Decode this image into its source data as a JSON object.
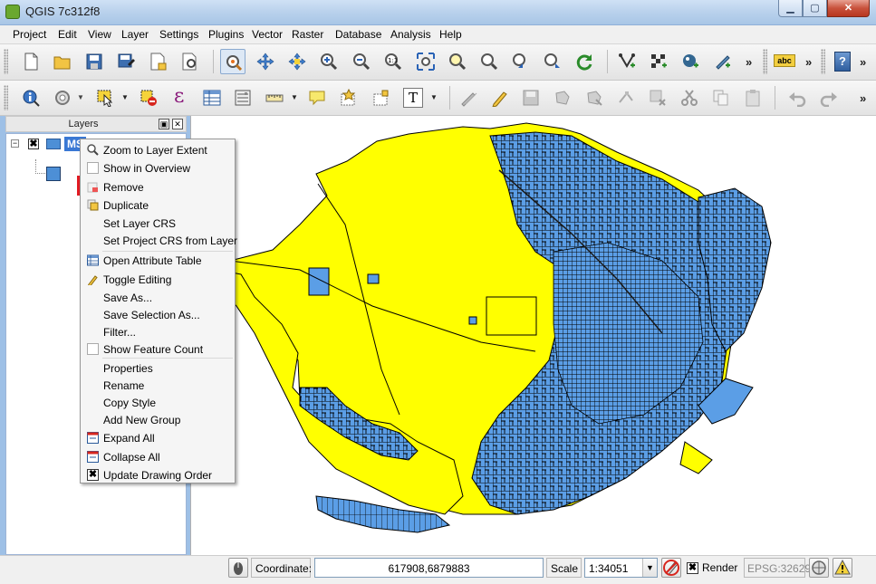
{
  "window": {
    "title": "QGIS 7c312f8",
    "minimize_label": "▁",
    "maximize_label": "▢",
    "close_label": "✕"
  },
  "menubar": {
    "items": [
      "Project",
      "Edit",
      "View",
      "Layer",
      "Settings",
      "Plugins",
      "Vector",
      "Raster",
      "Database",
      "Analysis",
      "Help"
    ]
  },
  "toolbar1": {
    "icons": [
      "new-project-icon",
      "open-project-icon",
      "save-project-icon",
      "save-as-icon",
      "new-print-composer-icon",
      "composer-manager-icon",
      "pan-map-icon",
      "pan-to-selection-icon",
      "touch-zoom-icon",
      "zoom-in-icon",
      "zoom-out-icon",
      "zoom-actual-size-icon",
      "zoom-full-icon",
      "zoom-to-selection-icon",
      "zoom-to-layer-icon",
      "zoom-last-icon",
      "zoom-next-icon",
      "refresh-icon",
      "add-vector-layer-icon",
      "add-raster-layer-icon",
      "add-postgis-layer-icon",
      "add-spatialite-layer-icon",
      "label-icon",
      "help-icon"
    ],
    "overflow": "»",
    "label_button": "abc",
    "help_button": "?"
  },
  "toolbar2": {
    "icons": [
      "identify-icon",
      "measure-icon",
      "select-icon",
      "deselect-icon",
      "expression-select-icon",
      "attribute-table-icon",
      "field-calculator-icon",
      "measure-line-icon",
      "map-tips-icon",
      "new-bookmark-icon",
      "show-bookmarks-icon",
      "text-annotation-icon",
      "current-edits-icon",
      "toggle-editing-icon",
      "save-edits-icon",
      "add-feature-icon",
      "move-feature-icon",
      "node-tool-icon",
      "delete-selected-icon",
      "cut-features-icon",
      "copy-features-icon",
      "paste-features-icon",
      "undo-icon",
      "redo-icon"
    ],
    "overflow": "»",
    "expression_glyph": "ε",
    "text_glyph": "T"
  },
  "layers_panel": {
    "title": "Layers",
    "float_label": "▣",
    "close_label": "✕",
    "expander": "−",
    "layer_checked": "✖",
    "layer_name": "MS"
  },
  "context_menu": {
    "items": [
      {
        "label": "Zoom to Layer Extent",
        "icon": "zoom-to-layer-icon"
      },
      {
        "label": "Show in Overview",
        "icon": "overview-checkbox-icon"
      },
      {
        "label": "Remove",
        "icon": "remove-layer-icon"
      },
      {
        "label": "Duplicate",
        "icon": "duplicate-layer-icon"
      },
      {
        "label": "Set Layer CRS",
        "icon": ""
      },
      {
        "label": "Set Project CRS from Layer",
        "icon": ""
      },
      {
        "label": "Open Attribute Table",
        "icon": "attribute-table-icon"
      },
      {
        "label": "Toggle Editing",
        "icon": "pencil-icon"
      },
      {
        "label": "Save As...",
        "icon": ""
      },
      {
        "label": "Save Selection As...",
        "icon": ""
      },
      {
        "label": "Filter...",
        "icon": ""
      },
      {
        "label": "Show Feature Count",
        "icon": "feature-count-checkbox-icon"
      },
      {
        "label": "Properties",
        "icon": ""
      },
      {
        "label": "Rename",
        "icon": ""
      },
      {
        "label": "Copy Style",
        "icon": ""
      },
      {
        "label": "Add New Group",
        "icon": ""
      },
      {
        "label": "Expand All",
        "icon": "expand-all-icon"
      },
      {
        "label": "Collapse All",
        "icon": "collapse-all-icon"
      },
      {
        "label": "Update Drawing Order",
        "icon": "update-order-icon"
      }
    ],
    "highlighted": "Remove",
    "update_order_glyph": "✖"
  },
  "statusbar": {
    "coordinate_label": "Coordinate:",
    "coordinate_value": "617908,6879883",
    "scale_label": "Scale",
    "scale_value": "1:34051",
    "scale_arrow": "▼",
    "render_checked": "✖",
    "render_label": "Render",
    "epsg": "EPSG:32629"
  },
  "colors": {
    "map_fill_yellow": "#ffff00",
    "map_fill_blue": "#5b9ee6",
    "map_stroke": "#000000",
    "highlight_red": "#e31b23",
    "selection_blue": "#3a78d4"
  }
}
